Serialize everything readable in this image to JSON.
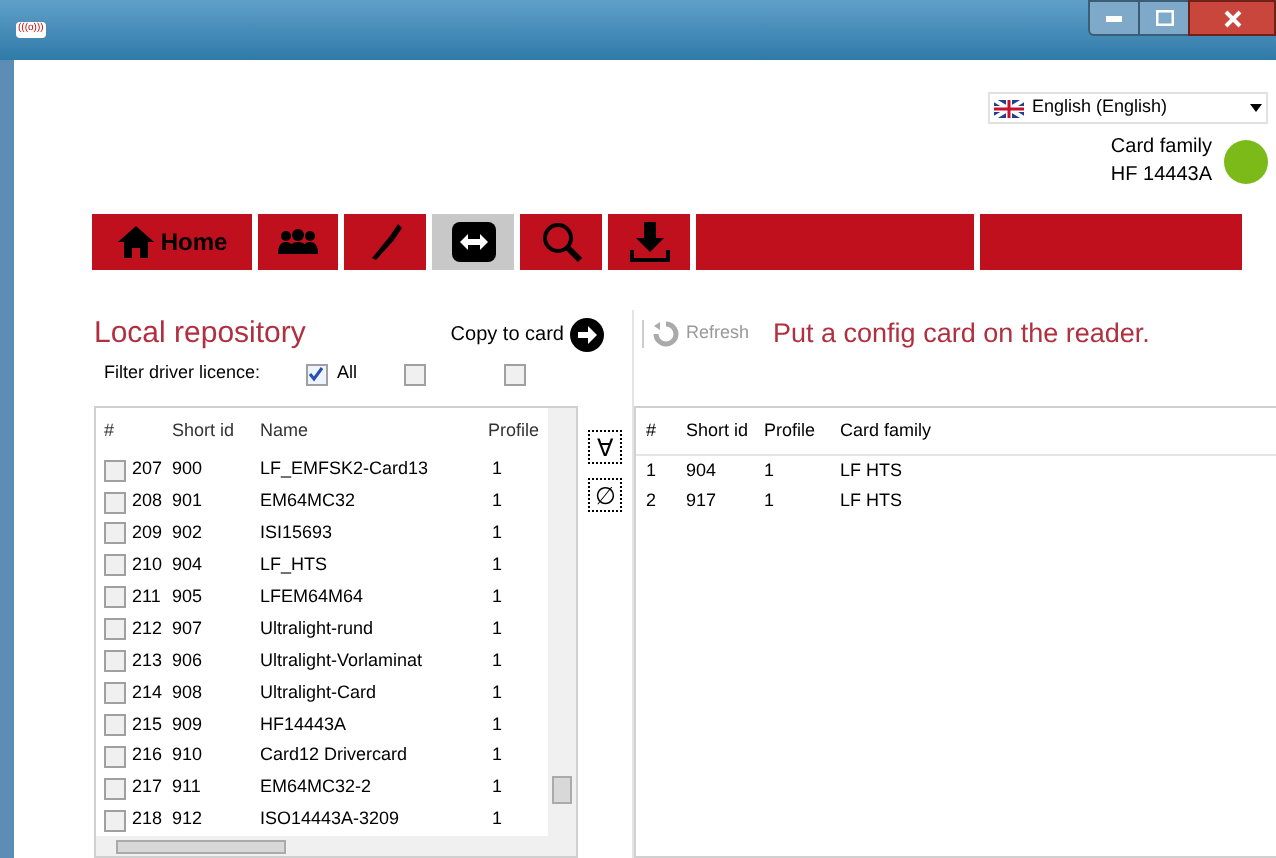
{
  "window": {
    "title_icon": "(((o)))"
  },
  "language": {
    "value": "English (English)"
  },
  "card_status": {
    "label": "Card family",
    "value": "HF 14443A",
    "color": "#7cba1a"
  },
  "toolbar": [
    {
      "kind": "home",
      "label": "Home",
      "selected": false
    },
    {
      "kind": "users",
      "selected": false
    },
    {
      "kind": "torch",
      "selected": false
    },
    {
      "kind": "swap",
      "selected": true
    },
    {
      "kind": "search",
      "selected": false
    },
    {
      "kind": "download",
      "selected": false
    },
    {
      "kind": "blank",
      "selected": false
    },
    {
      "kind": "blank",
      "selected": false
    }
  ],
  "local": {
    "title": "Local repository",
    "copy_label": "Copy to card",
    "filter_label": "Filter driver licence:",
    "filters": [
      {
        "label": "All",
        "checked": true
      },
      {
        "checked": false
      },
      {
        "checked": false
      }
    ],
    "columns": [
      "#",
      "Short id",
      "Name",
      "Profile"
    ],
    "rows": [
      {
        "checked": false,
        "cells": [
          "207",
          "900",
          "LF_EMFSK2-Card13",
          "1"
        ]
      },
      {
        "checked": false,
        "cells": [
          "208",
          "901",
          "EM64MC32",
          "1"
        ]
      },
      {
        "checked": false,
        "cells": [
          "209",
          "902",
          "ISI15693",
          "1"
        ]
      },
      {
        "checked": false,
        "cells": [
          "210",
          "904",
          "LF_HTS",
          "1"
        ]
      },
      {
        "checked": false,
        "cells": [
          "211",
          "905",
          "LFEM64M64",
          "1"
        ]
      },
      {
        "checked": false,
        "cells": [
          "212",
          "907",
          "Ultralight-rund",
          "1"
        ]
      },
      {
        "checked": false,
        "cells": [
          "213",
          "906",
          "Ultralight-Vorlaminat",
          "1"
        ]
      },
      {
        "checked": false,
        "cells": [
          "214",
          "908",
          "Ultralight-Card",
          "1"
        ]
      },
      {
        "checked": false,
        "cells": [
          "215",
          "909",
          "HF14443A",
          "1"
        ]
      },
      {
        "checked": false,
        "cells": [
          "216",
          "910",
          "Card12 Drivercard",
          "1"
        ]
      },
      {
        "checked": false,
        "cells": [
          "217",
          "911",
          "EM64MC32-2",
          "1"
        ]
      },
      {
        "checked": false,
        "cells": [
          "218",
          "912",
          "ISO14443A-3209",
          "1"
        ]
      }
    ]
  },
  "select_buttons": [
    "∀",
    "∅"
  ],
  "card": {
    "refresh_label": "Refresh",
    "message": "Put a config card on the reader.",
    "columns": [
      "#",
      "Short id",
      "Profile",
      "Card family"
    ],
    "rows": [
      [
        "1",
        "904",
        "1",
        "LF HTS"
      ],
      [
        "2",
        "917",
        "1",
        "LF HTS"
      ]
    ]
  }
}
